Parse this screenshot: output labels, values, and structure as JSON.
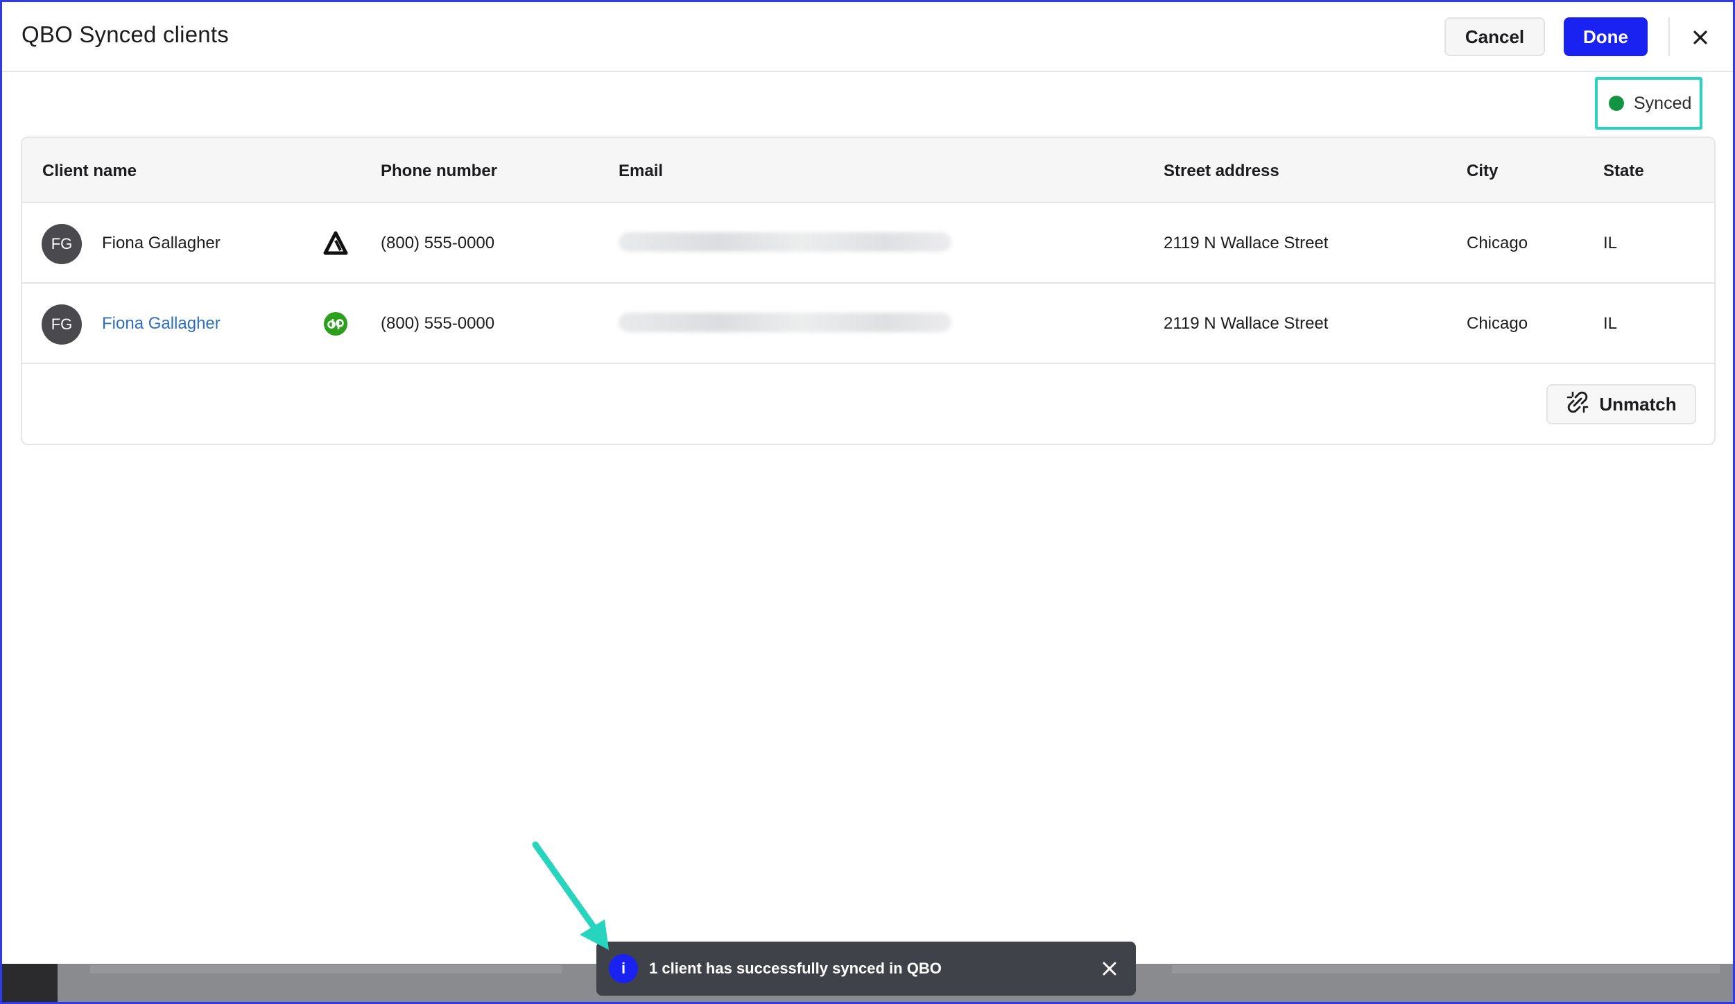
{
  "header": {
    "title": "QBO Synced clients",
    "cancel_label": "Cancel",
    "done_label": "Done",
    "close_icon": "close-icon"
  },
  "status": {
    "label": "Synced",
    "dot_color": "#139442"
  },
  "table": {
    "columns": [
      "Client name",
      "Phone number",
      "Email",
      "Street address",
      "City",
      "State"
    ],
    "rows": [
      {
        "initials": "FG",
        "name": "Fiona Gallagher",
        "source_icon": "app-logo-icon",
        "phone": "(800) 555-0000",
        "street": "2119 N Wallace Street",
        "city": "Chicago",
        "state": "IL"
      },
      {
        "initials": "FG",
        "name": "Fiona Gallagher",
        "source_icon": "quickbooks-icon",
        "phone": "(800) 555-0000",
        "street": "2119 N Wallace Street",
        "city": "Chicago",
        "state": "IL"
      }
    ],
    "unmatch_label": "Unmatch"
  },
  "toast": {
    "icon": "info-icon",
    "message": "1 client has successfully synced in QBO"
  },
  "colors": {
    "accent": "#1a22f2",
    "highlight": "#27d4bd",
    "link": "#2d6fbf",
    "quickbooks_green": "#2ca01c"
  }
}
